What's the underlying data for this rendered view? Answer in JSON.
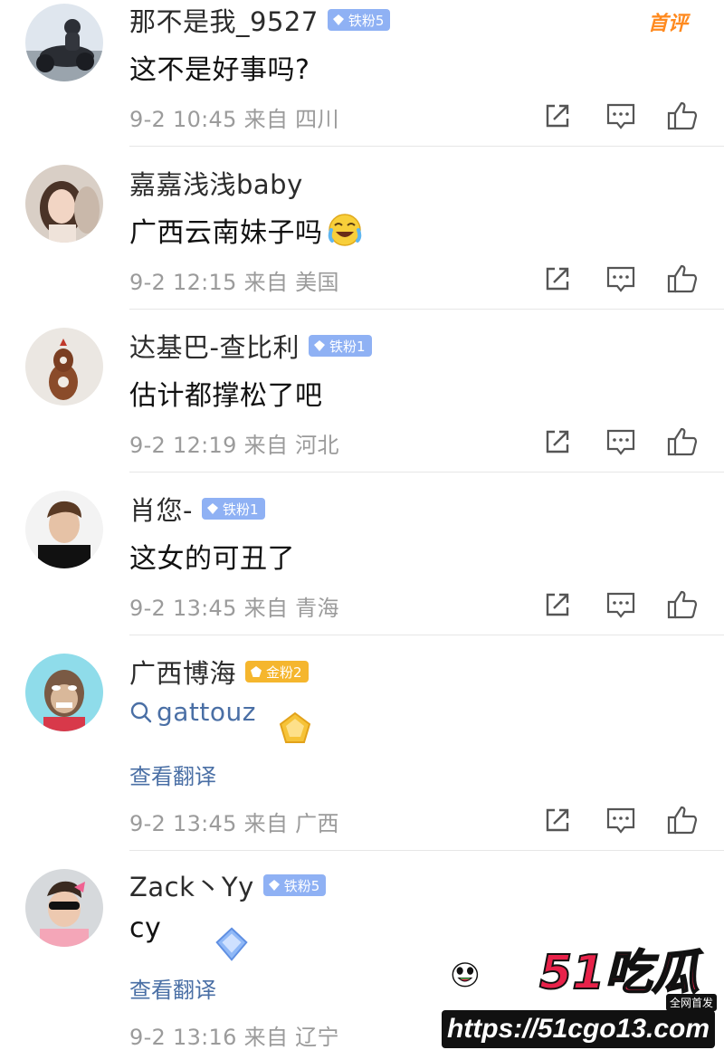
{
  "comments": [
    {
      "user": "那不是我_9527",
      "badge": "铁粉5",
      "badge_type": "iron",
      "text": "这不是好事吗?",
      "time": "9-2 10:45",
      "from": "来自 四川",
      "tag": "首评"
    },
    {
      "user": "嘉嘉浅浅baby",
      "badge": "",
      "text": "广西云南妹子吗",
      "emoji": "laughing-crying-emoji",
      "time": "9-2 12:15",
      "from": "来自 美国"
    },
    {
      "user": "达基巴-查比利",
      "badge": "铁粉1",
      "badge_type": "iron",
      "text": "估计都撑松了吧",
      "time": "9-2 12:19",
      "from": "来自 河北"
    },
    {
      "user": "肖您-",
      "badge": "铁粉1",
      "badge_type": "iron",
      "text": "这女的可丑了",
      "time": "9-2 13:45",
      "from": "来自 青海"
    },
    {
      "user": "广西博海",
      "badge": "金粉2",
      "badge_type": "gold",
      "text": "gattouz",
      "translate": "查看翻译",
      "time": "9-2 13:45",
      "from": "来自 广西"
    },
    {
      "user": "Zack丶Yy",
      "badge": "铁粉5",
      "badge_type": "iron",
      "text": "cy",
      "translate": "查看翻译",
      "time": "9-2 13:16",
      "from": "来自 辽宁"
    }
  ],
  "icons": {
    "share": "share-icon",
    "reply": "comment-icon",
    "like": "thumbs-up-icon",
    "search": "search-icon"
  },
  "watermark": {
    "brand": "51吃瓜",
    "tag": "全网首发",
    "url": "https://51cgo13.com"
  },
  "colors": {
    "first_comment": "#ff8a1f",
    "iron_badge": "#8fb1f4",
    "gold_badge": "#f5b62e",
    "link": "#4a6fa5"
  }
}
